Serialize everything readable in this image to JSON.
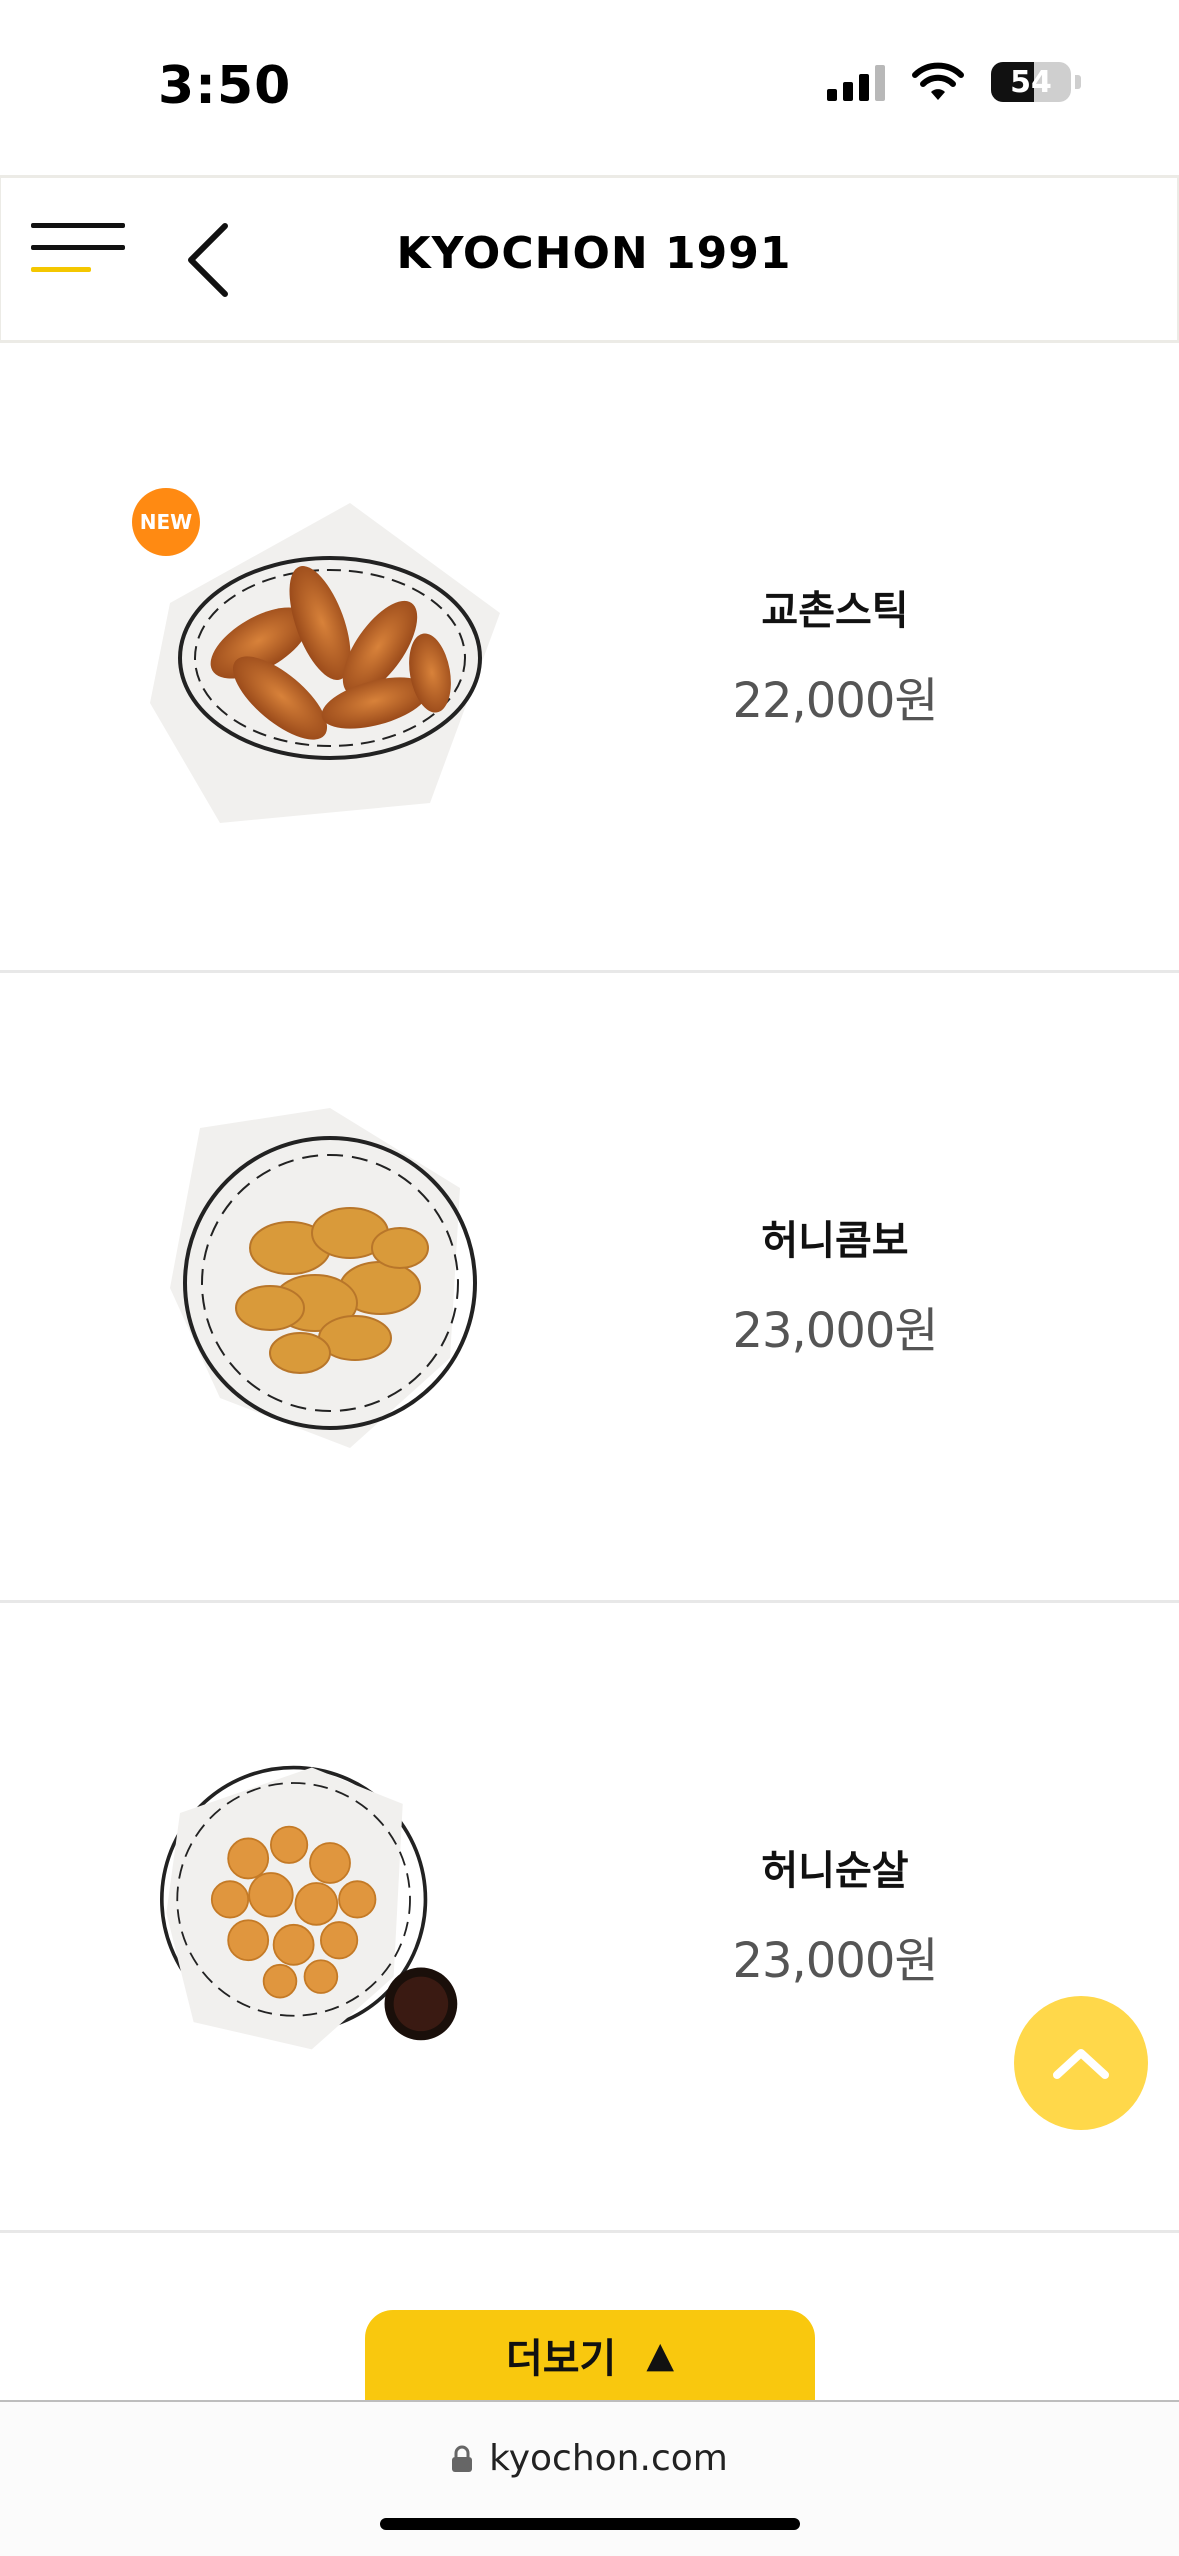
{
  "status_bar": {
    "time": "3:50",
    "battery": "54",
    "battery_level": 0.54,
    "icons": [
      "signal-icon",
      "wifi-icon",
      "battery-icon"
    ]
  },
  "header": {
    "brand": "KYOCHON 1991",
    "icons": [
      "hamburger-menu-icon",
      "back-chevron-icon"
    ],
    "accent_color": "#f4c700"
  },
  "products": [
    {
      "name": "교촌스틱",
      "price": "22,000원",
      "badge": "NEW"
    },
    {
      "name": "허니콤보",
      "price": "23,000원",
      "badge": ""
    },
    {
      "name": "허니순살",
      "price": "23,000원",
      "badge": ""
    }
  ],
  "more_button": {
    "label": "더보기",
    "arrow": "▲",
    "color": "#f9c80e"
  },
  "scroll_top": {
    "icon": "chevron-up-icon",
    "color": "#ffd84a"
  },
  "browser": {
    "url": "kyochon.com",
    "icon": "lock-icon"
  },
  "colors": {
    "badge": "#ff8a12",
    "price_text": "#555555"
  }
}
